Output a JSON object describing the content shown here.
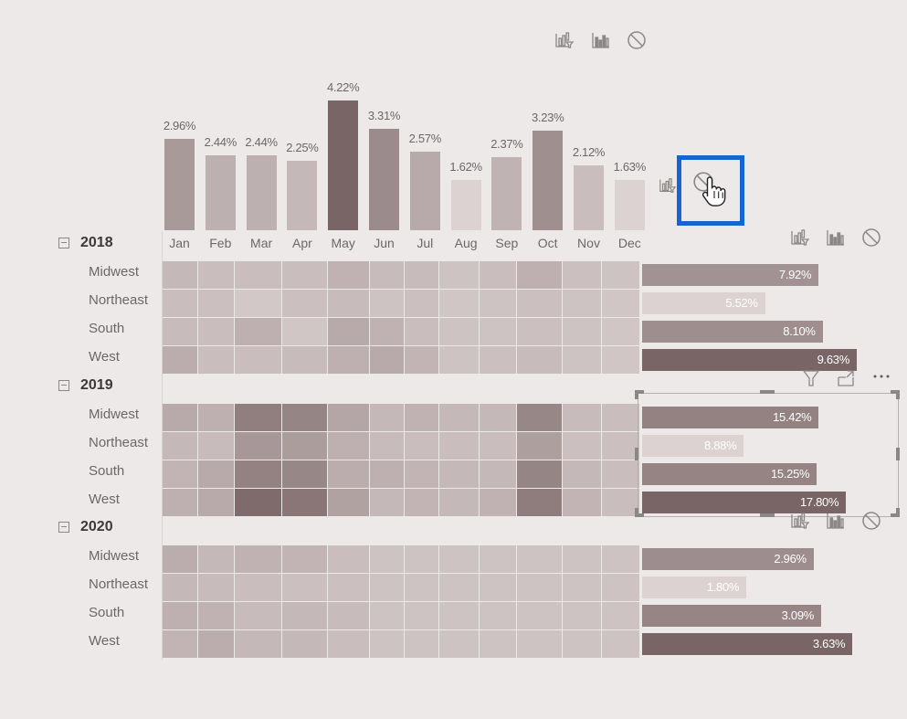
{
  "toolbar_top": {
    "icons": [
      "drill-filter-icon",
      "bar-chart-icon",
      "no-impact-icon"
    ]
  },
  "column_chart": {
    "categories": [
      "Jan",
      "Feb",
      "Mar",
      "Apr",
      "May",
      "Jun",
      "Jul",
      "Aug",
      "Sep",
      "Oct",
      "Nov",
      "Dec"
    ],
    "labels": [
      "2.96%",
      "2.44%",
      "2.44%",
      "2.25%",
      "4.22%",
      "3.31%",
      "2.57%",
      "1.62%",
      "2.37%",
      "3.23%",
      "2.12%",
      "1.63%"
    ],
    "color_scale": {
      "low": "#dcd2d2",
      "high": "#7a6566"
    }
  },
  "chart_data": {
    "type": "bar",
    "title": "",
    "categories": [
      "Jan",
      "Feb",
      "Mar",
      "Apr",
      "May",
      "Jun",
      "Jul",
      "Aug",
      "Sep",
      "Oct",
      "Nov",
      "Dec"
    ],
    "values": [
      2.96,
      2.44,
      2.44,
      2.25,
      4.22,
      3.31,
      2.57,
      1.62,
      2.37,
      3.23,
      2.12,
      1.63
    ],
    "value_format": "percent",
    "xlabel": "",
    "ylabel": "",
    "ylim": [
      0,
      4.22
    ],
    "grid": false,
    "data_labels": [
      "2.96%",
      "2.44%",
      "2.44%",
      "2.25%",
      "4.22%",
      "3.31%",
      "2.57%",
      "1.62%",
      "2.37%",
      "3.23%",
      "2.12%",
      "1.63%"
    ]
  },
  "highlighted_control": {
    "icon": "no-impact-icon",
    "cursor": "hand-pointer-icon",
    "highlight_color": "#1565d0"
  },
  "matrix": {
    "months": [
      "Jan",
      "Feb",
      "Mar",
      "Apr",
      "May",
      "Jun",
      "Jul",
      "Aug",
      "Sep",
      "Oct",
      "Nov",
      "Dec"
    ],
    "groups": [
      {
        "year": "2018",
        "rows": [
          {
            "region": "Midwest",
            "intensity": [
              0.25,
              0.2,
              0.2,
              0.2,
              0.3,
              0.22,
              0.22,
              0.15,
              0.2,
              0.32,
              0.18,
              0.15
            ],
            "total": "7.92%",
            "total_value": 7.92
          },
          {
            "region": "Northeast",
            "intensity": [
              0.2,
              0.18,
              0.1,
              0.18,
              0.22,
              0.15,
              0.18,
              0.12,
              0.15,
              0.18,
              0.15,
              0.12
            ],
            "total": "5.52%",
            "total_value": 5.52
          },
          {
            "region": "South",
            "intensity": [
              0.22,
              0.2,
              0.32,
              0.12,
              0.38,
              0.3,
              0.2,
              0.15,
              0.15,
              0.18,
              0.15,
              0.12
            ],
            "total": "8.10%",
            "total_value": 8.1
          },
          {
            "region": "West",
            "intensity": [
              0.35,
              0.2,
              0.2,
              0.22,
              0.32,
              0.38,
              0.28,
              0.15,
              0.18,
              0.22,
              0.15,
              0.12
            ],
            "total": "9.63%",
            "total_value": 9.63
          }
        ]
      },
      {
        "year": "2019",
        "rows": [
          {
            "region": "Midwest",
            "intensity": [
              0.38,
              0.32,
              0.78,
              0.72,
              0.42,
              0.25,
              0.3,
              0.25,
              0.25,
              0.7,
              0.22,
              0.2
            ],
            "total": "15.42%",
            "total_value": 15.42
          },
          {
            "region": "Northeast",
            "intensity": [
              0.25,
              0.22,
              0.55,
              0.5,
              0.32,
              0.22,
              0.2,
              0.2,
              0.2,
              0.48,
              0.18,
              0.18
            ],
            "total": "8.88%",
            "total_value": 8.88
          },
          {
            "region": "South",
            "intensity": [
              0.28,
              0.38,
              0.75,
              0.7,
              0.35,
              0.32,
              0.28,
              0.25,
              0.25,
              0.72,
              0.25,
              0.2
            ],
            "total": "15.25%",
            "total_value": 15.25
          },
          {
            "region": "West",
            "intensity": [
              0.32,
              0.38,
              0.95,
              0.85,
              0.45,
              0.25,
              0.28,
              0.25,
              0.3,
              0.8,
              0.28,
              0.2
            ],
            "total": "17.80%",
            "total_value": 17.8
          }
        ]
      },
      {
        "year": "2020",
        "rows": [
          {
            "region": "Midwest",
            "intensity": [
              0.35,
              0.25,
              0.3,
              0.28,
              0.2,
              0.15,
              0.15,
              0.15,
              0.15,
              0.15,
              0.15,
              0.15
            ],
            "total": "2.96%",
            "total_value": 2.96
          },
          {
            "region": "Northeast",
            "intensity": [
              0.25,
              0.22,
              0.2,
              0.18,
              0.18,
              0.15,
              0.15,
              0.15,
              0.15,
              0.15,
              0.15,
              0.15
            ],
            "total": "1.80%",
            "total_value": 1.8
          },
          {
            "region": "South",
            "intensity": [
              0.32,
              0.3,
              0.22,
              0.25,
              0.22,
              0.15,
              0.15,
              0.15,
              0.15,
              0.15,
              0.15,
              0.15
            ],
            "total": "3.09%",
            "total_value": 3.09
          },
          {
            "region": "West",
            "intensity": [
              0.28,
              0.35,
              0.25,
              0.25,
              0.2,
              0.15,
              0.15,
              0.15,
              0.15,
              0.15,
              0.15,
              0.15
            ],
            "total": "3.63%",
            "total_value": 3.63
          }
        ]
      }
    ]
  },
  "bar_totals_max": 17.8,
  "visual_header_icons": [
    "filter-icon",
    "focus-mode-icon",
    "more-options-icon"
  ]
}
